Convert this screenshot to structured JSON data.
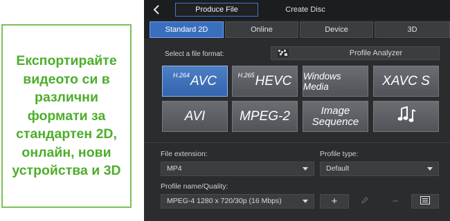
{
  "callout": {
    "text": "Експортирайте видеото си в различни формати за стандартен 2D, онлайн, нови устройства и 3D"
  },
  "topbar": {
    "back_icon": "chevron-left-icon",
    "produce_tab": "Produce File",
    "create_disc_tab": "Create Disc"
  },
  "tabs": [
    "Standard 2D",
    "Online",
    "Device",
    "3D"
  ],
  "select_format_label": "Select a file format:",
  "profile_analyzer": {
    "icon": "profile-analyzer-icon",
    "label": "Profile Analyzer"
  },
  "formats": {
    "avc": {
      "sup": "H.264",
      "label": "AVC"
    },
    "hevc": {
      "sup": "H.265",
      "label": "HEVC"
    },
    "wmv": {
      "label": "Windows Media"
    },
    "xavc": {
      "label": "XAVC S"
    },
    "avi": {
      "label": "AVI"
    },
    "mpeg2": {
      "label": "MPEG-2"
    },
    "image_seq": {
      "line1": "Image",
      "line2": "Sequence"
    },
    "audio": {
      "icon": "music-notes-icon"
    }
  },
  "file_extension": {
    "label": "File extension:",
    "value": "MP4"
  },
  "profile_type": {
    "label": "Profile type:",
    "value": "Default"
  },
  "profile_name": {
    "label": "Profile name/Quality:",
    "value": "MPEG-4 1280 x 720/30p (16 Mbps)"
  },
  "tools": {
    "add": "+",
    "remove": "−"
  },
  "colors": {
    "accent": "#3a6fbe",
    "callout_green": "#4cae2a",
    "panel": "#2b2c2e"
  }
}
